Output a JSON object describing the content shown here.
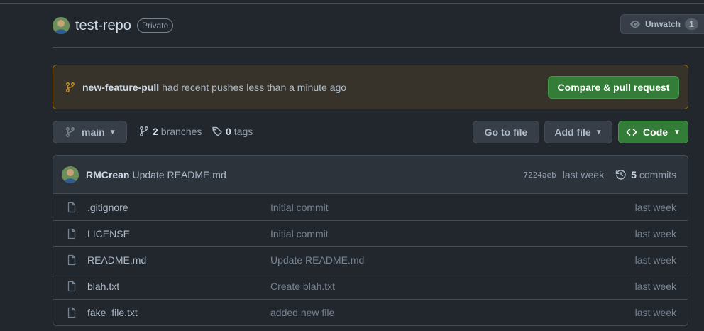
{
  "repo": {
    "name": "test-repo",
    "visibility": "Private",
    "watch_label": "Unwatch",
    "watch_count": "1"
  },
  "banner": {
    "branch": "new-feature-pull",
    "text": "had recent pushes less than a minute ago",
    "button": "Compare & pull request"
  },
  "toolbar": {
    "branch": "main",
    "branches_count": "2",
    "branches_label": "branches",
    "tags_count": "0",
    "tags_label": "tags",
    "goto_file": "Go to file",
    "add_file": "Add file",
    "code": "Code"
  },
  "latest_commit": {
    "author": "RMCrean",
    "message": "Update README.md",
    "sha": "7224aeb",
    "time": "last week",
    "commits_count": "5",
    "commits_label": "commits"
  },
  "files": [
    {
      "name": ".gitignore",
      "commit": "Initial commit",
      "age": "last week"
    },
    {
      "name": "LICENSE",
      "commit": "Initial commit",
      "age": "last week"
    },
    {
      "name": "README.md",
      "commit": "Update README.md",
      "age": "last week"
    },
    {
      "name": "blah.txt",
      "commit": "Create blah.txt",
      "age": "last week"
    },
    {
      "name": "fake_file.txt",
      "commit": "added new file",
      "age": "last week"
    }
  ],
  "colors": {
    "background": "#22272e",
    "accent_green": "#347d39",
    "banner_border": "#966600"
  },
  "icons": [
    "eye-icon",
    "git-branch-icon",
    "tag-icon",
    "code-icon",
    "history-icon",
    "file-icon"
  ]
}
